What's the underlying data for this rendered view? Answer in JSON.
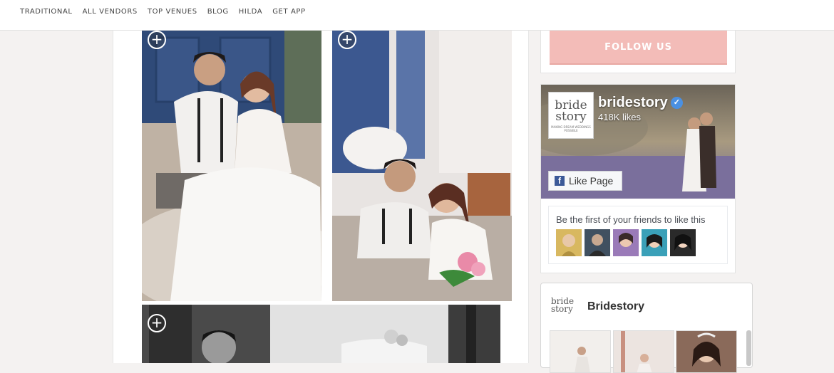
{
  "nav": {
    "items": [
      "TRADITIONAL",
      "ALL VENDORS",
      "TOP VENUES",
      "BLOG",
      "HILDA",
      "GET APP"
    ]
  },
  "gallery": {
    "plus_symbol": "+"
  },
  "sidebar": {
    "follow_label": "FOLLOW US",
    "facebook": {
      "logo_text": "bride story",
      "logo_tagline": "MAKING DREAM WEDDINGS POSSIBLE",
      "page_name": "bridestory",
      "verified_symbol": "✓",
      "likes": "418K likes",
      "like_button": "Like Page",
      "fb_letter": "f",
      "friends_text": "Be the first of your friends to like this"
    },
    "bridestory_widget": {
      "logo_text": "bride story",
      "title": "Bridestory"
    }
  },
  "colors": {
    "follow_button": "#f3bcb8",
    "verified_badge": "#4a90e2",
    "facebook_blue": "#3b5998"
  }
}
